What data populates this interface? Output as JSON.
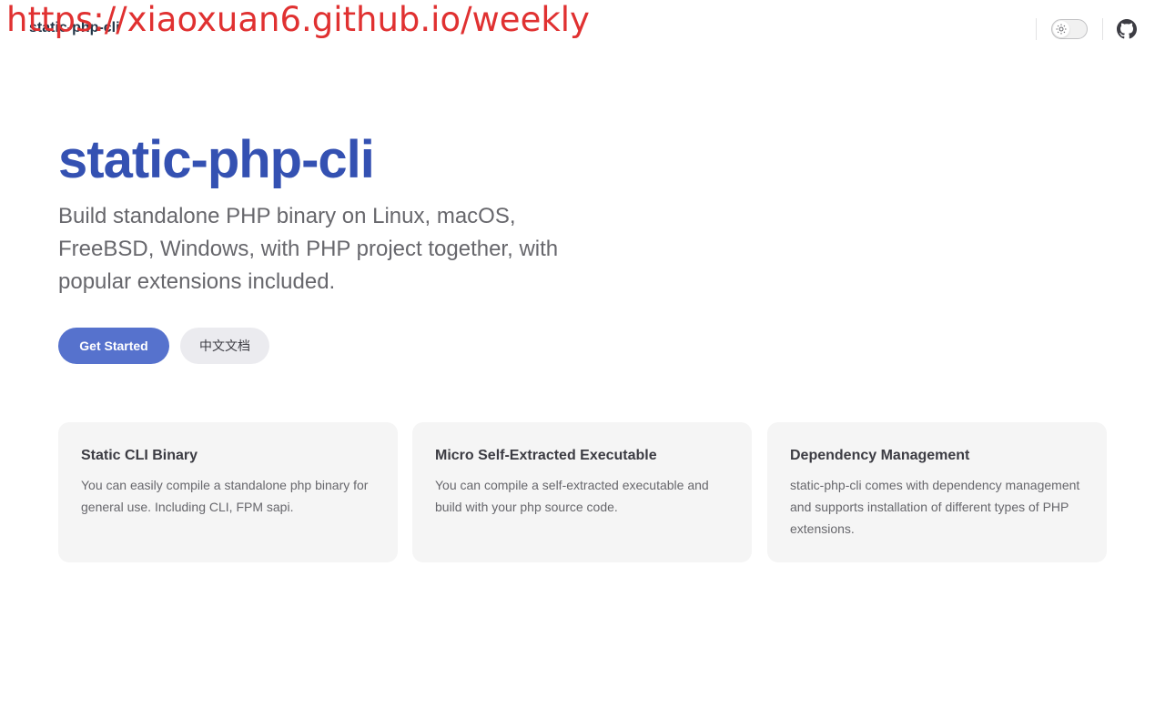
{
  "nav": {
    "title": "static-php-cli",
    "github_label": "GitHub"
  },
  "overlay": {
    "url_text": "https://xiaoxuan6.github.io/weekly"
  },
  "hero": {
    "name": "static-php-cli",
    "tagline": "Build standalone PHP binary on Linux, macOS, FreeBSD, Windows, with PHP project together, with popular extensions included.",
    "actions": [
      {
        "label": "Get Started"
      },
      {
        "label": "中文文档"
      }
    ]
  },
  "features": [
    {
      "title": "Static CLI Binary",
      "details": "You can easily compile a standalone php binary for general use. Including CLI, FPM sapi."
    },
    {
      "title": "Micro Self-Extracted Executable",
      "details": "You can compile a self-extracted executable and build with your php source code."
    },
    {
      "title": "Dependency Management",
      "details": "static-php-cli comes with dependency management and supports installation of different types of PHP extensions."
    }
  ],
  "colors": {
    "brand": "#3451b2",
    "button_brand": "#5672cd",
    "overlay_red": "#e03131"
  },
  "icons": [
    "sun-icon",
    "github-icon"
  ]
}
